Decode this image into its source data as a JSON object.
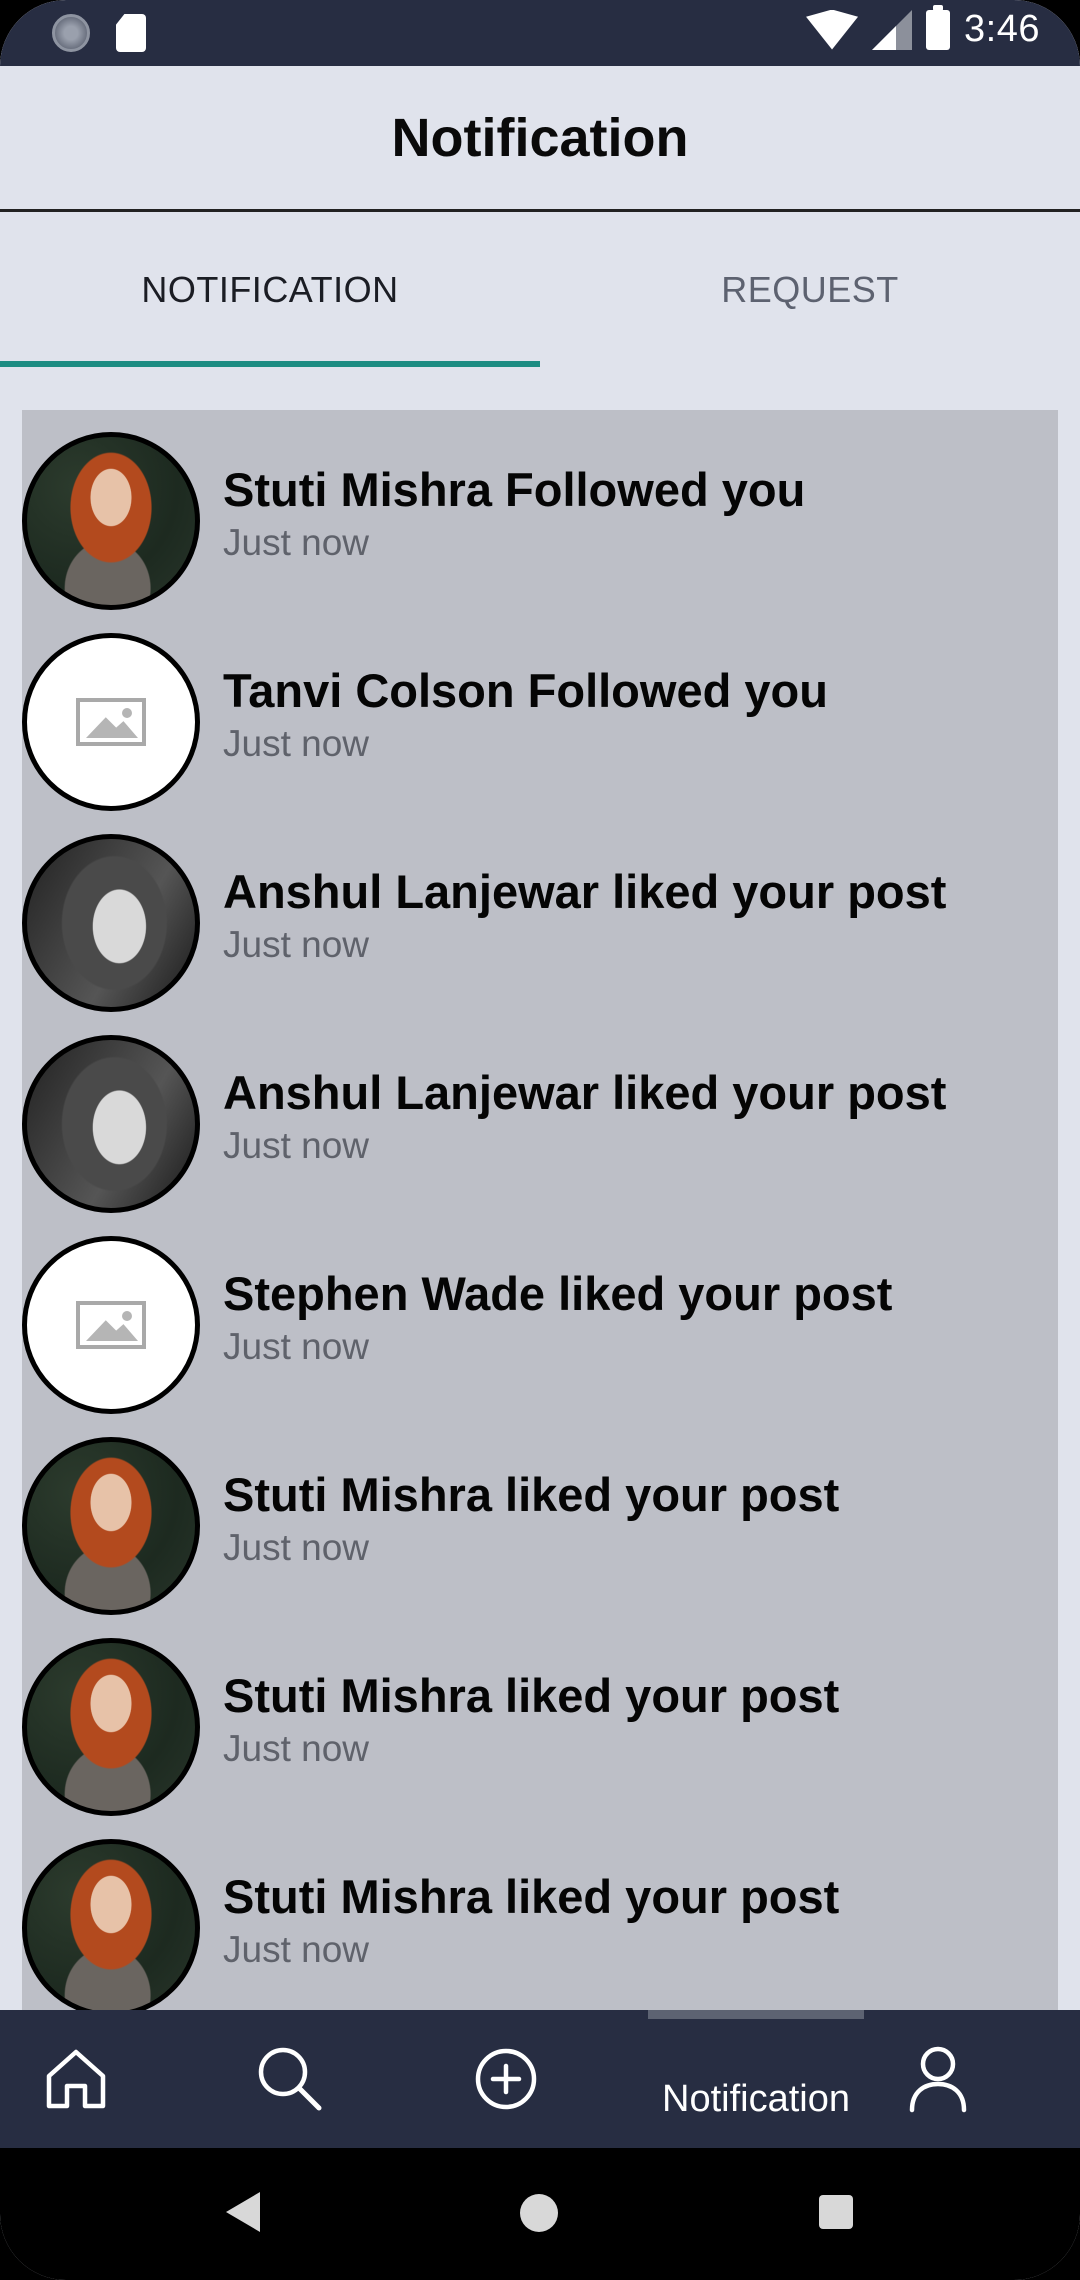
{
  "status_bar": {
    "time": "3:46",
    "icons": [
      "sync-icon",
      "sd-card-icon",
      "wifi-icon",
      "signal-icon",
      "battery-icon"
    ]
  },
  "header": {
    "title": "Notification"
  },
  "tabs": [
    {
      "label": "NOTIFICATION",
      "active": true
    },
    {
      "label": "REQUEST",
      "active": false
    }
  ],
  "notifications": [
    {
      "text": "Stuti Mishra Followed you",
      "time": "Just now",
      "avatar": "photo-red-hair"
    },
    {
      "text": "Tanvi Colson Followed you",
      "time": "Just now",
      "avatar": "placeholder"
    },
    {
      "text": "Anshul Lanjewar liked your post",
      "time": "Just now",
      "avatar": "photo-bw"
    },
    {
      "text": "Anshul Lanjewar liked your post",
      "time": "Just now",
      "avatar": "photo-bw"
    },
    {
      "text": "Stephen Wade liked your post",
      "time": "Just now",
      "avatar": "placeholder"
    },
    {
      "text": "Stuti Mishra liked your post",
      "time": "Just now",
      "avatar": "photo-red-hair"
    },
    {
      "text": "Stuti Mishra liked your post",
      "time": "Just now",
      "avatar": "photo-red-hair"
    },
    {
      "text": "Stuti Mishra liked your post",
      "time": "Just now",
      "avatar": "photo-red-hair"
    }
  ],
  "bottom_nav": {
    "items": [
      "home-icon",
      "search-icon",
      "add-icon",
      "notification",
      "profile-icon"
    ],
    "active_label": "Notification"
  },
  "colors": {
    "bar_bg": "#272d42",
    "page_bg": "#e0e3ec",
    "list_bg": "#bdbfc7",
    "tab_indicator": "#1d8c82"
  }
}
